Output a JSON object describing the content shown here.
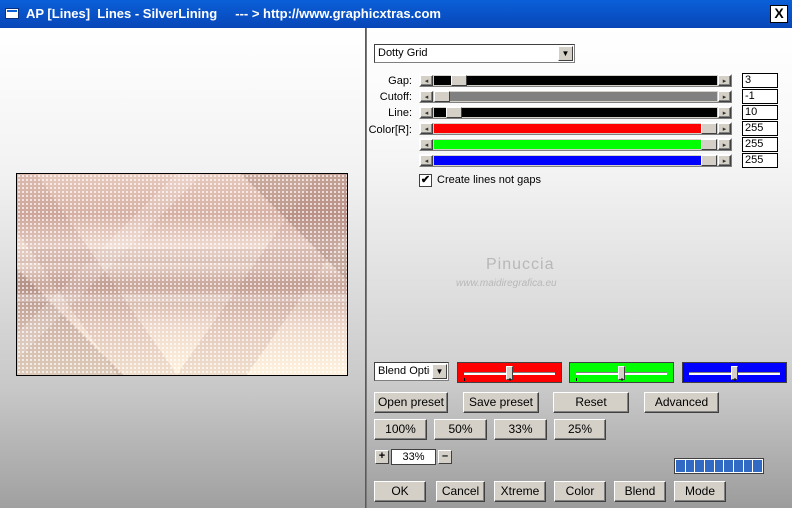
{
  "window": {
    "title": "AP [Lines]  Lines - SilverLining     --- > http://www.graphicxtras.com",
    "close_label": "X"
  },
  "preset_dropdown": {
    "value": "Dotty Grid"
  },
  "sliders": [
    {
      "label": "Gap:",
      "value": "3"
    },
    {
      "label": "Cutoff:",
      "value": "-1"
    },
    {
      "label": "Line:",
      "value": "10"
    },
    {
      "label": "Color[R]:",
      "value": "255"
    },
    {
      "label": "",
      "value": "255"
    },
    {
      "label": "",
      "value": "255"
    }
  ],
  "colors": {
    "red": "#ff0000",
    "green": "#00ff00",
    "blue": "#0000ff",
    "gap_fill": "#000000",
    "cutoff_fill": "#808080"
  },
  "create_lines_checkbox": {
    "label": "Create lines not gaps",
    "checked": true,
    "mark": "✔"
  },
  "watermark": {
    "line1": "Pinuccia",
    "line2": "www.maidiregrafica.eu"
  },
  "blend_dropdown": {
    "value": "Blend Optio"
  },
  "buttons": {
    "open_preset": "Open preset",
    "save_preset": "Save preset",
    "reset": "Reset",
    "advanced": "Advanced",
    "zoom_100": "100%",
    "zoom_50": "50%",
    "zoom_33": "33%",
    "zoom_25": "25%",
    "ok": "OK",
    "cancel": "Cancel",
    "xtreme": "Xtreme",
    "color": "Color",
    "blend": "Blend",
    "mode": "Mode"
  },
  "zoom": {
    "plus": "+",
    "minus": "–",
    "value": "33%"
  },
  "icons": {
    "close": "close-icon",
    "dropdown": "chevron-down-icon",
    "arrow_left": "◂",
    "arrow_right": "▸",
    "arrow_down": "▼"
  }
}
